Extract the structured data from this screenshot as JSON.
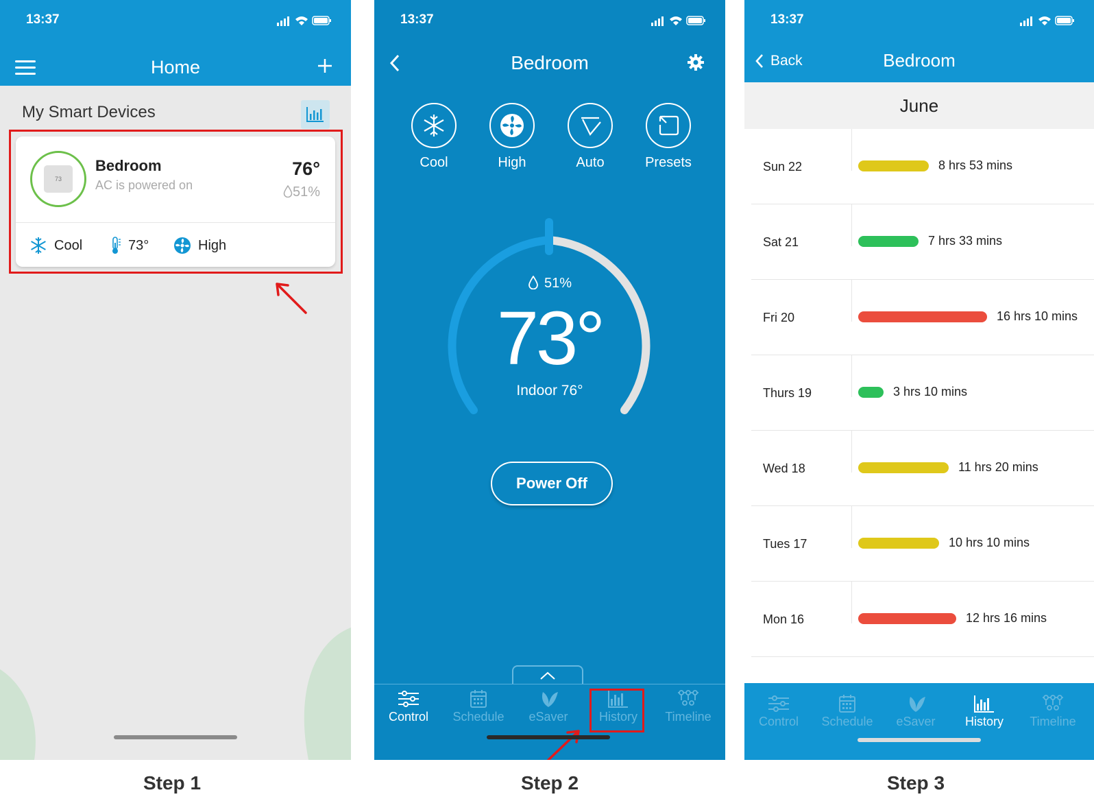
{
  "status": {
    "time": "13:37"
  },
  "steps": [
    "Step 1",
    "Step 2",
    "Step 3"
  ],
  "colors": {
    "accent": "#1296d3",
    "accent_dark": "#0a86c1",
    "highlight": "#e11b1b",
    "bar_yellow": "#dfc81a",
    "bar_green": "#2dc05a",
    "bar_red": "#eb4d3d"
  },
  "home": {
    "title": "Home",
    "section_title": "My Smart Devices",
    "device": {
      "name": "Bedroom",
      "status": "AC is powered on",
      "temperature": "76°",
      "humidity": "51%",
      "thumb_text": "73",
      "mode": "Cool",
      "setpoint": "73°",
      "fan": "High"
    }
  },
  "control": {
    "title": "Bedroom",
    "modes": [
      {
        "label": "Cool",
        "icon": "snowflake-icon"
      },
      {
        "label": "High",
        "icon": "fan-icon"
      },
      {
        "label": "Auto",
        "icon": "swing-icon"
      },
      {
        "label": "Presets",
        "icon": "presets-icon"
      }
    ],
    "humidity": "51%",
    "setpoint": "73°",
    "indoor": "Indoor 76°",
    "power_button": "Power Off",
    "tabs": [
      "Control",
      "Schedule",
      "eSaver",
      "History",
      "Timeline"
    ]
  },
  "history": {
    "back": "Back",
    "title": "Bedroom",
    "month": "June",
    "rows": [
      {
        "day": "Sun 22",
        "duration": "8 hrs 53 mins",
        "minutes": 533,
        "color": "#dfc81a"
      },
      {
        "day": "Sat 21",
        "duration": "7 hrs 33 mins",
        "minutes": 453,
        "color": "#2dc05a"
      },
      {
        "day": "Fri 20",
        "duration": "16 hrs 10 mins",
        "minutes": 970,
        "color": "#eb4d3d"
      },
      {
        "day": "Thurs 19",
        "duration": "3 hrs 10 mins",
        "minutes": 190,
        "color": "#2dc05a"
      },
      {
        "day": "Wed 18",
        "duration": "11 hrs 20 mins",
        "minutes": 680,
        "color": "#dfc81a"
      },
      {
        "day": "Tues 17",
        "duration": "10 hrs 10 mins",
        "minutes": 610,
        "color": "#dfc81a"
      },
      {
        "day": "Mon 16",
        "duration": "12 hrs 16 mins",
        "minutes": 736,
        "color": "#eb4d3d"
      }
    ],
    "tabs": [
      "Control",
      "Schedule",
      "eSaver",
      "History",
      "Timeline"
    ]
  }
}
